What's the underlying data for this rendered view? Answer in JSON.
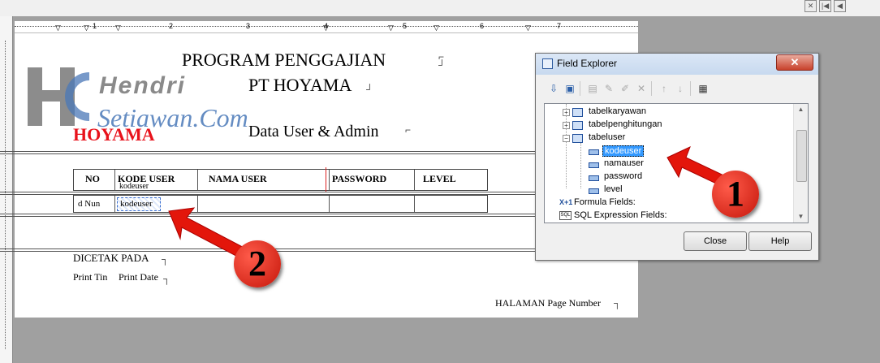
{
  "topbar": {
    "nav_buttons": [
      "✕",
      "|◀",
      "◀"
    ]
  },
  "ruler": {
    "numbers": [
      "1",
      "2",
      "3",
      "4",
      "5",
      "6",
      "7"
    ]
  },
  "report": {
    "title": "PROGRAM PENGGAJIAN",
    "company": "PT HOYAMA",
    "subtitle": "Data User & Admin",
    "logo_text": "HOYAMA",
    "watermark_line1": "Hendri",
    "watermark_line2": "Setiawan.Com",
    "columns": [
      "NO",
      "KODE USER",
      "NAMA USER",
      "PASSWORD",
      "LEVEL"
    ],
    "column_subfield": "kodeuser",
    "detail_fields": [
      "d Nun",
      "kodeuser"
    ],
    "footer_label": "DICETAK PADA",
    "footer_print_time": "Print Tin",
    "footer_print_date": "Print Date",
    "page_label": "HALAMAN Page Number"
  },
  "field_explorer": {
    "title": "Field Explorer",
    "close_x": "✕",
    "tree": [
      {
        "label": "tabelkaryawan",
        "level": 1,
        "expander": "+",
        "icon": "table-icon"
      },
      {
        "label": "tabelpenghitungan",
        "level": 1,
        "expander": "+",
        "icon": "table-icon"
      },
      {
        "label": "tabeluser",
        "level": 1,
        "expander": "−",
        "icon": "table-icon"
      },
      {
        "label": "kodeuser",
        "level": 2,
        "icon": "field-icon",
        "selected": true
      },
      {
        "label": "namauser",
        "level": 2,
        "icon": "field-icon"
      },
      {
        "label": "password",
        "level": 2,
        "icon": "field-icon"
      },
      {
        "label": "level",
        "level": 2,
        "icon": "field-icon"
      },
      {
        "label": "Formula Fields:",
        "level": 0,
        "icon": "formula-icon"
      },
      {
        "label": "SQL Expression Fields:",
        "level": 0,
        "icon": "sql-icon"
      }
    ],
    "buttons": {
      "close": "Close",
      "help": "Help"
    }
  },
  "annotations": {
    "badge1": "1",
    "badge2": "2"
  },
  "colors": {
    "accent": "#3399ff",
    "logo_red": "#e8121b",
    "badge_red": "#d21b0e",
    "arrow_red": "#e3160b"
  }
}
